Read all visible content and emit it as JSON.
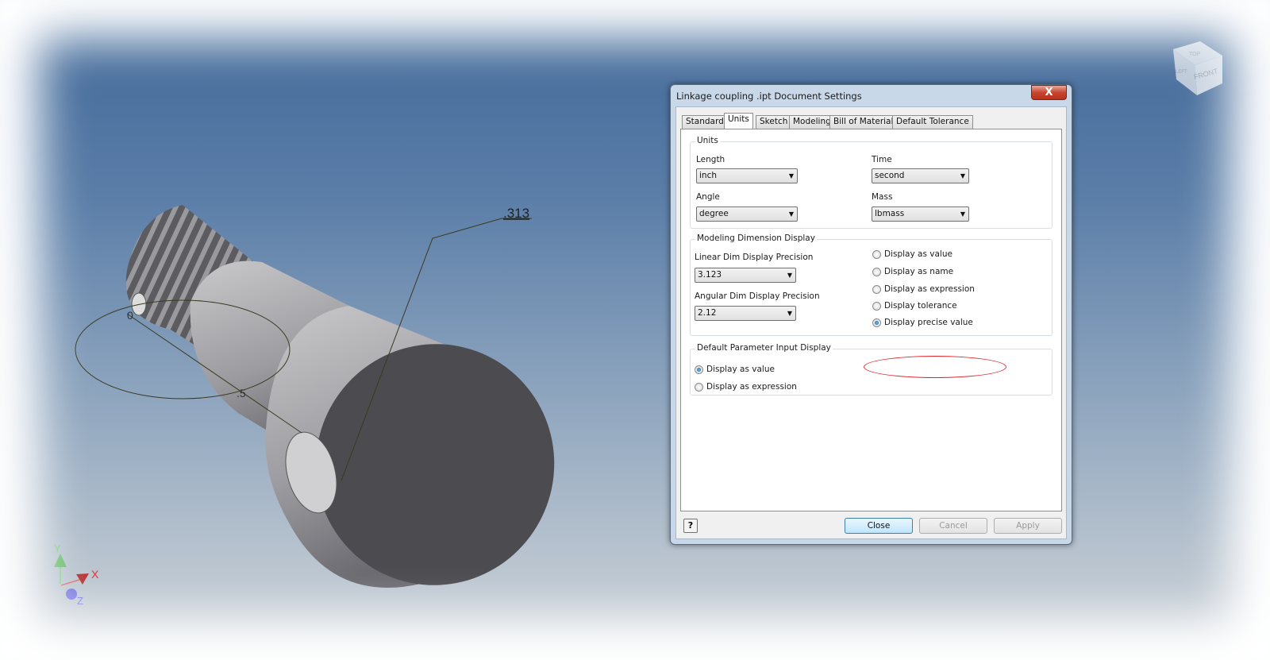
{
  "viewport": {
    "dimension_main": ".313",
    "dimension_small": ".5",
    "dimension_zero": "0",
    "axes": {
      "x": "X",
      "y": "Y",
      "z": "Z"
    },
    "viewcube": {
      "top": "TOP",
      "front": "FRONT",
      "left": "LEFT"
    }
  },
  "dialog": {
    "title": "Linkage coupling .ipt Document Settings",
    "close_glyph": "X",
    "tabs": [
      "Standard",
      "Units",
      "Sketch",
      "Modeling",
      "Bill of Materials",
      "Default Tolerance"
    ],
    "active_tab": "Units",
    "units": {
      "group": "Units",
      "length_label": "Length",
      "length_value": "inch",
      "time_label": "Time",
      "time_value": "second",
      "angle_label": "Angle",
      "angle_value": "degree",
      "mass_label": "Mass",
      "mass_value": "lbmass"
    },
    "modeling_dim": {
      "group": "Modeling Dimension Display",
      "linear_label": "Linear Dim Display Precision",
      "linear_value": "3.123",
      "angular_label": "Angular Dim Display Precision",
      "angular_value": "2.12",
      "options": [
        "Display as value",
        "Display as name",
        "Display as expression",
        "Display tolerance",
        "Display precise value"
      ],
      "selected": "Display precise value"
    },
    "param_input": {
      "group": "Default Parameter Input Display",
      "options": [
        "Display as value",
        "Display as expression"
      ],
      "selected": "Display as value"
    },
    "buttons": {
      "help": "?",
      "close": "Close",
      "cancel": "Cancel",
      "apply": "Apply"
    }
  },
  "colors": {
    "highlight": "#e0262b",
    "selected_radio": "#0b4a86"
  }
}
